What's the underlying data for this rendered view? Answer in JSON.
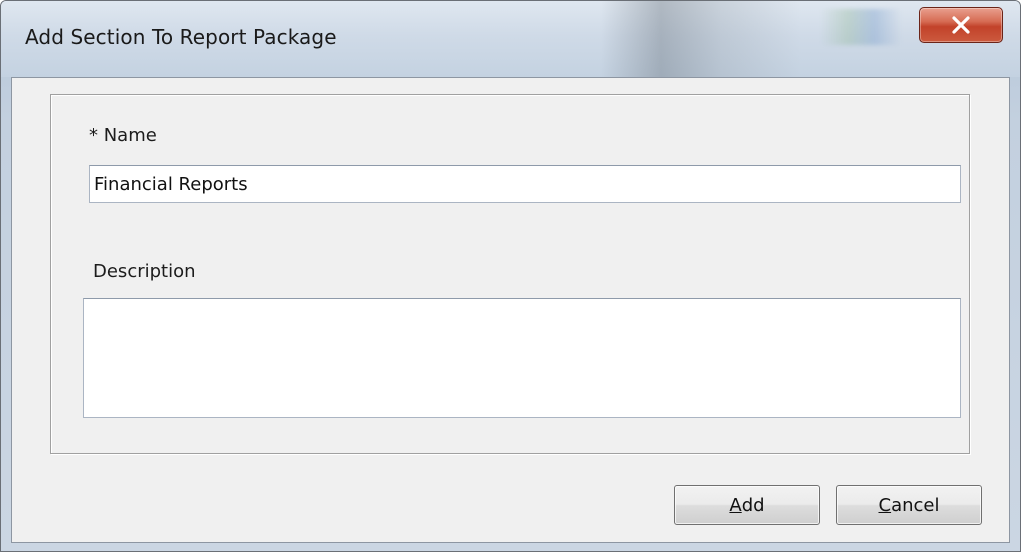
{
  "window": {
    "title": "Add Section To Report Package",
    "close_glyph": "X"
  },
  "form": {
    "name_label": "* Name",
    "name_value": "Financial Reports",
    "description_label": "Description",
    "description_value": ""
  },
  "buttons": {
    "add": {
      "mnemonic": "A",
      "rest": "dd"
    },
    "cancel": {
      "mnemonic": "C",
      "rest": "ancel"
    }
  },
  "icons": {
    "close": "close-icon"
  },
  "colors": {
    "close_button": "#c2422a",
    "dialog_background": "#f0f0f0",
    "frame": "#c3d0df"
  }
}
